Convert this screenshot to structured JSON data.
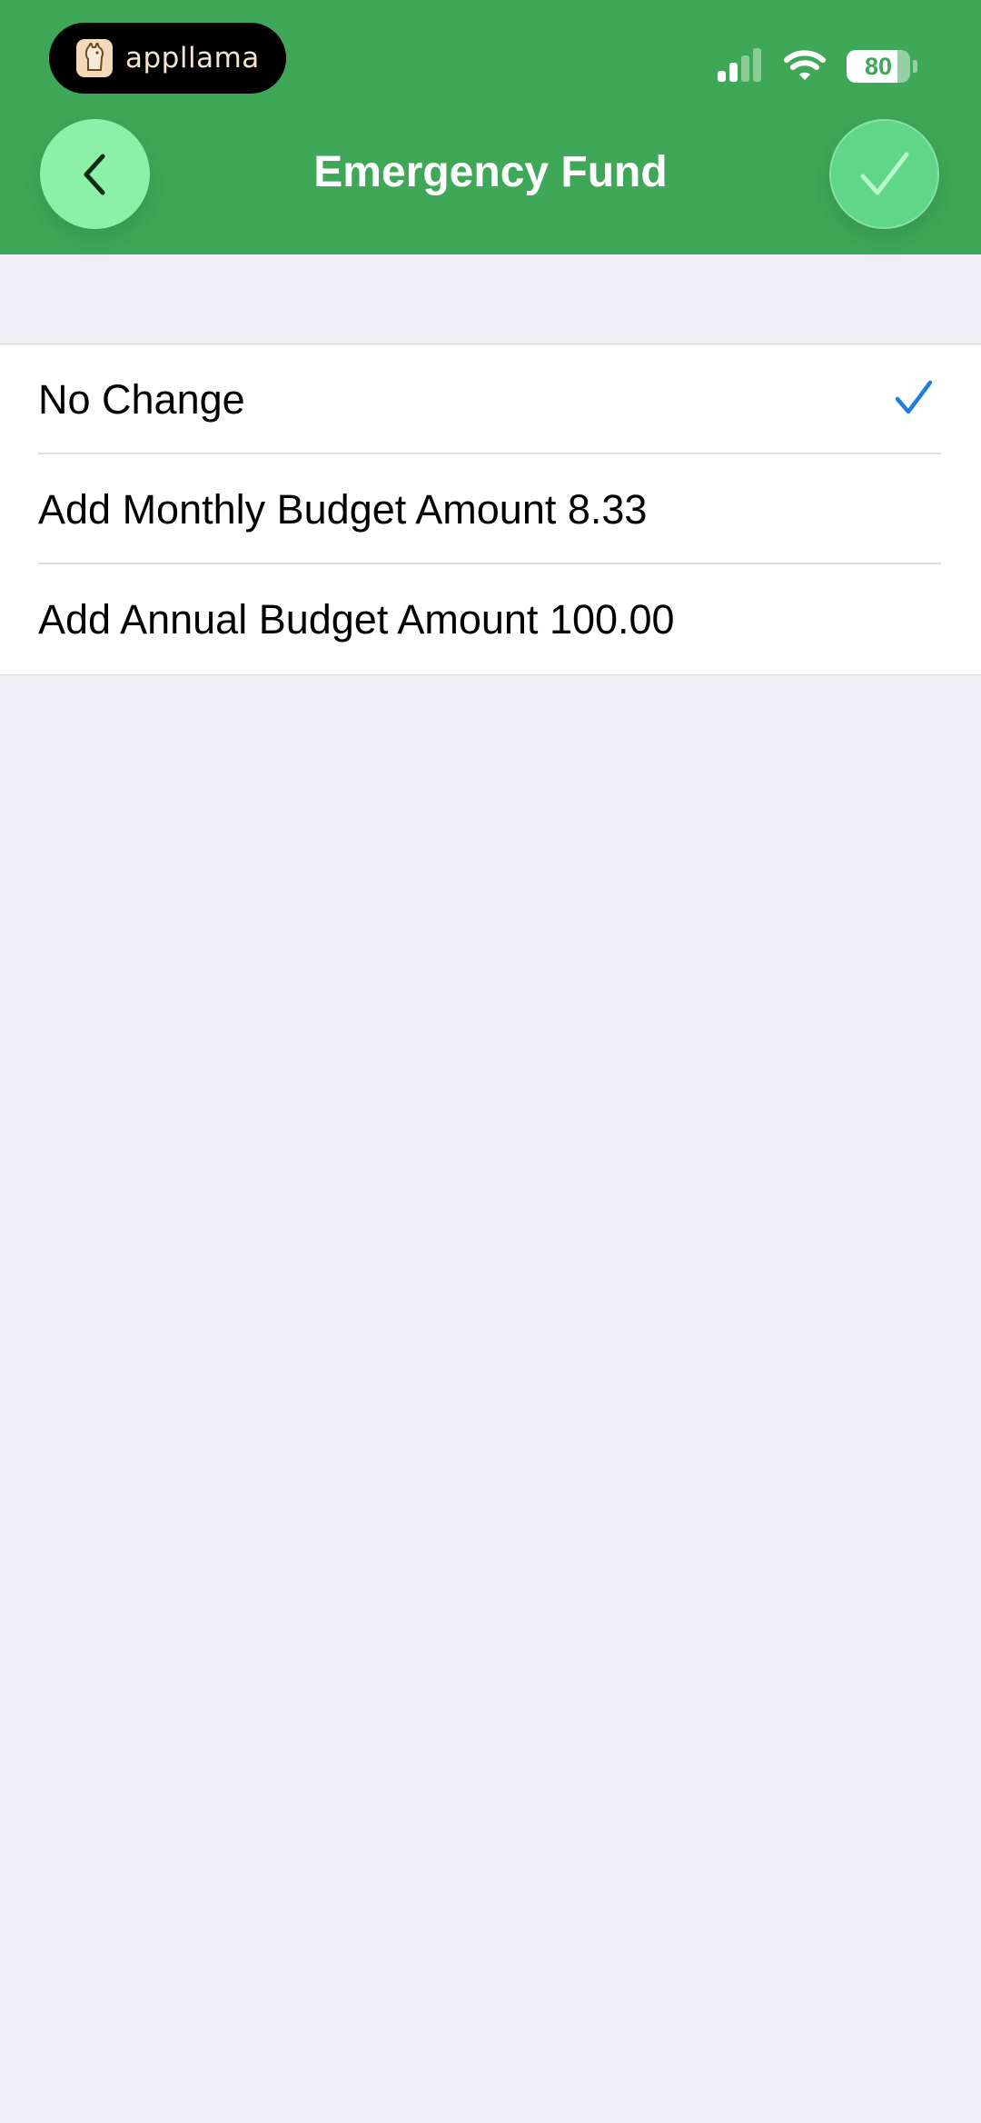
{
  "status_bar": {
    "brand": "appllama",
    "battery_level": "80",
    "signal_bars_active": 2,
    "signal_bars_total": 4
  },
  "header": {
    "title": "Emergency Fund",
    "back_icon": "chevron-left-icon",
    "done_icon": "checkmark-icon"
  },
  "options": [
    {
      "label": "No Change",
      "selected": true
    },
    {
      "label": "Add Monthly Budget Amount 8.33",
      "selected": false
    },
    {
      "label": "Add Annual Budget Amount 100.00",
      "selected": false
    }
  ],
  "colors": {
    "header_bg": "#3fa858",
    "back_button_bg": "#8df0a8",
    "done_button_bg": "#5fd688",
    "checkmark": "#1f7fe0",
    "page_bg": "#efeff5"
  }
}
